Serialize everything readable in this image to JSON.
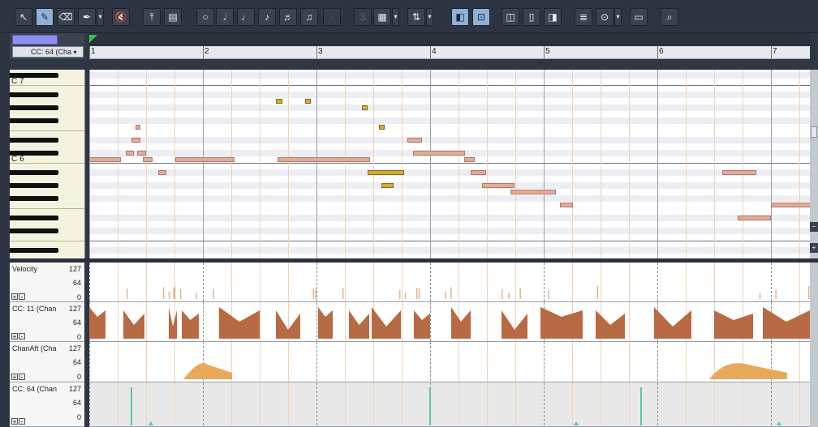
{
  "toolbar": {
    "buttons": [
      {
        "name": "select-tool-button",
        "icon": "select-arrow-icon",
        "glyph": "↖",
        "left": 0,
        "active": false
      },
      {
        "name": "draw-tool-button",
        "icon": "pencil-icon",
        "glyph": "✎",
        "active": true
      },
      {
        "name": "erase-tool-button",
        "icon": "eraser-icon",
        "glyph": "⌫",
        "active": false
      },
      {
        "name": "pen-tool-button",
        "icon": "pen-icon",
        "glyph": "✒",
        "active": false
      },
      {
        "name": "mute-tool-button",
        "icon": "mute-speaker-icon",
        "glyph": "🔇",
        "active": false
      },
      {
        "name": "quantize-button",
        "icon": "quantize-icon",
        "glyph": "⤒",
        "active": false
      },
      {
        "name": "controller-pane-button",
        "icon": "controller-pane-icon",
        "glyph": "▤",
        "active": false
      },
      {
        "name": "whole-note-button",
        "icon": "whole-note-icon",
        "glyph": "○",
        "active": false
      },
      {
        "name": "half-note-button",
        "icon": "half-note-icon",
        "glyph": "𝅗𝅥",
        "active": false
      },
      {
        "name": "quarter-note-button",
        "icon": "quarter-note-icon",
        "glyph": "♩",
        "active": false
      },
      {
        "name": "eighth-note-button",
        "icon": "eighth-note-icon",
        "glyph": "♪",
        "active": false
      },
      {
        "name": "sixteenth-note-button",
        "icon": "sixteenth-note-icon",
        "glyph": "♬",
        "active": false
      },
      {
        "name": "thirtysecond-note-button",
        "icon": "thirtysecond-note-icon",
        "glyph": "♫",
        "active": false
      },
      {
        "name": "dot-button",
        "icon": "dot-icon",
        "glyph": "·",
        "active": false
      },
      {
        "name": "triplet-button",
        "icon": "triplet-icon",
        "glyph": "3",
        "active": false
      },
      {
        "name": "snap-grid-button",
        "icon": "grid-icon",
        "glyph": "▦",
        "active": false
      },
      {
        "name": "transpose-button",
        "icon": "up-down-arrows-icon",
        "glyph": "⇅",
        "active": false
      },
      {
        "name": "audition-button",
        "icon": "audition-speaker-icon",
        "glyph": "◧",
        "active": true
      },
      {
        "name": "show-events-button",
        "icon": "show-events-icon",
        "glyph": "⊡",
        "active": true
      },
      {
        "name": "pane-left-button",
        "icon": "pane-left-icon",
        "glyph": "◫",
        "active": false
      },
      {
        "name": "pane-center-button",
        "icon": "pane-center-icon",
        "glyph": "▯",
        "active": false
      },
      {
        "name": "pane-right-button",
        "icon": "pane-right-icon",
        "glyph": "◨",
        "active": false
      },
      {
        "name": "track-list-button",
        "icon": "track-list-icon",
        "glyph": "≣",
        "active": false
      },
      {
        "name": "record-button",
        "icon": "record-icon",
        "glyph": "⊙",
        "active": false
      },
      {
        "name": "inline-view-button",
        "icon": "inline-view-icon",
        "glyph": "▭",
        "active": false
      },
      {
        "name": "zoom-button",
        "icon": "magnifier-icon",
        "glyph": "⌕",
        "active": false
      }
    ]
  },
  "header": {
    "instrument_label": "",
    "controller_select": "CC: 64 (Cha",
    "dropdown_glyph": "▾"
  },
  "ruler": {
    "measures": [
      "1",
      "2",
      "3",
      "4",
      "5",
      "6",
      "7"
    ]
  },
  "keyboard": {
    "octave_labels": [
      "C 7",
      "C 6"
    ]
  },
  "lanes": [
    {
      "id": "velocity",
      "name": "Velocity",
      "max": "127",
      "mid": "64",
      "min": "0"
    },
    {
      "id": "cc11",
      "name": "CC: 11 (Chan",
      "max": "127",
      "mid": "64",
      "min": "0"
    },
    {
      "id": "chanaft",
      "name": "ChanAft (Cha",
      "max": "127",
      "mid": "64",
      "min": "0"
    },
    {
      "id": "cc64",
      "name": "CC: 64 (Chan",
      "max": "127",
      "mid": "64",
      "min": "0"
    }
  ],
  "lane_buttons": {
    "plus": "+",
    "minus": "-"
  },
  "colors": {
    "note_fill": "#e4aa96",
    "note_selected": "#d4aa36",
    "controller_fill": "#b86a44",
    "velocity_fill": "#e0b48a",
    "aftertouch_fill": "#e8aa5a",
    "sustain_line": "#5cc8a8",
    "toolbar_bg": "#2d3442",
    "active_button": "#8fb0d8"
  },
  "notes": [
    {
      "start": 0.0,
      "dur": 0.28,
      "pitch": 84,
      "sel": false
    },
    {
      "start": 0.32,
      "dur": 0.07,
      "pitch": 85,
      "sel": false
    },
    {
      "start": 0.37,
      "dur": 0.08,
      "pitch": 87,
      "sel": false
    },
    {
      "start": 0.42,
      "dur": 0.08,
      "pitch": 85,
      "sel": false
    },
    {
      "start": 0.41,
      "dur": 0.04,
      "pitch": 89,
      "sel": false
    },
    {
      "start": 0.47,
      "dur": 0.09,
      "pitch": 84,
      "sel": false
    },
    {
      "start": 0.61,
      "dur": 0.07,
      "pitch": 82,
      "sel": false
    },
    {
      "start": 0.76,
      "dur": 0.52,
      "pitch": 84,
      "sel": false
    },
    {
      "start": 1.64,
      "dur": 0.06,
      "pitch": 93,
      "sel": true
    },
    {
      "start": 1.9,
      "dur": 0.05,
      "pitch": 93,
      "sel": true
    },
    {
      "start": 1.66,
      "dur": 0.81,
      "pitch": 84,
      "sel": false
    },
    {
      "start": 2.4,
      "dur": 0.05,
      "pitch": 92,
      "sel": true
    },
    {
      "start": 2.55,
      "dur": 0.05,
      "pitch": 89,
      "sel": true
    },
    {
      "start": 2.45,
      "dur": 0.32,
      "pitch": 82,
      "sel": true
    },
    {
      "start": 2.57,
      "dur": 0.11,
      "pitch": 80,
      "sel": true
    },
    {
      "start": 2.8,
      "dur": 0.13,
      "pitch": 87,
      "sel": false
    },
    {
      "start": 2.85,
      "dur": 0.46,
      "pitch": 85,
      "sel": false
    },
    {
      "start": 3.3,
      "dur": 0.09,
      "pitch": 84,
      "sel": false
    },
    {
      "start": 3.36,
      "dur": 0.13,
      "pitch": 82,
      "sel": false
    },
    {
      "start": 3.46,
      "dur": 0.28,
      "pitch": 80,
      "sel": false
    },
    {
      "start": 3.71,
      "dur": 0.4,
      "pitch": 79,
      "sel": false
    },
    {
      "start": 4.14,
      "dur": 0.12,
      "pitch": 77,
      "sel": false
    },
    {
      "start": 5.57,
      "dur": 0.3,
      "pitch": 82,
      "sel": false
    },
    {
      "start": 5.71,
      "dur": 0.29,
      "pitch": 75,
      "sel": false
    },
    {
      "start": 6.0,
      "dur": 1.0,
      "pitch": 77,
      "sel": false
    }
  ]
}
